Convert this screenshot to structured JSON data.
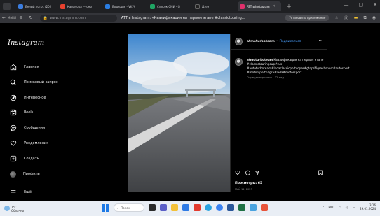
{
  "browser": {
    "tabs": [
      {
        "label": "Белый лотос (202",
        "color": "#3b7de0",
        "active": false
      },
      {
        "label": "Карамора — смо",
        "color": "#e8412e",
        "active": false
      },
      {
        "label": "Водящие - VK Ч",
        "color": "#2a7de1",
        "active": false
      },
      {
        "label": "Список СМИ - G",
        "color": "#1fa463",
        "active": false
      },
      {
        "label": "Дзен",
        "color": "#222222",
        "active": false
      },
      {
        "label": "ATT в Instagram",
        "color": "#e1306c",
        "active": true
      }
    ],
    "address": {
      "site_badge": "МиБЛ",
      "url": "www.instagram.com",
      "title": "ATT в Instagram: «Квалификация на первом этапе #classictouring...",
      "install_label": "Установить приложение"
    }
  },
  "sidebar": {
    "logo": "Instagram",
    "items": [
      {
        "label": "Главная",
        "icon": "home-icon"
      },
      {
        "label": "Поисковый запрос",
        "icon": "search-icon"
      },
      {
        "label": "Интересное",
        "icon": "compass-icon"
      },
      {
        "label": "Reels",
        "icon": "reels-icon"
      },
      {
        "label": "Сообщения",
        "icon": "messenger-icon"
      },
      {
        "label": "Уведомления",
        "icon": "heart-icon"
      },
      {
        "label": "Создать",
        "icon": "plus-square-icon"
      },
      {
        "label": "Профиль",
        "icon": "avatar"
      },
      {
        "label": "Ещё",
        "icon": "menu-icon"
      }
    ]
  },
  "post": {
    "username": "atmoturboteam",
    "follow_label": "Подписаться",
    "more_label": "···",
    "caption": "Квалификация на первом этапе #classictouringcup#rus #autoturboteam#ladaclassicportsoper#gtoprifigrachsport#autosport #motorsportnagra#lada#motorsport",
    "caption_meta": "Отредактировано · 32 нед.",
    "views": "Просмотры: 65",
    "date": "МАЙ 11, 2023"
  },
  "taskbar": {
    "weather_temp": "7°C",
    "weather_desc": "Облачно",
    "search_placeholder": "Поиск",
    "lang": "ENG",
    "time": "3:16",
    "date": "29.01.2024"
  },
  "colors": {
    "accent": "#0095f6",
    "link": "#4ba0ff",
    "background": "#000000"
  }
}
